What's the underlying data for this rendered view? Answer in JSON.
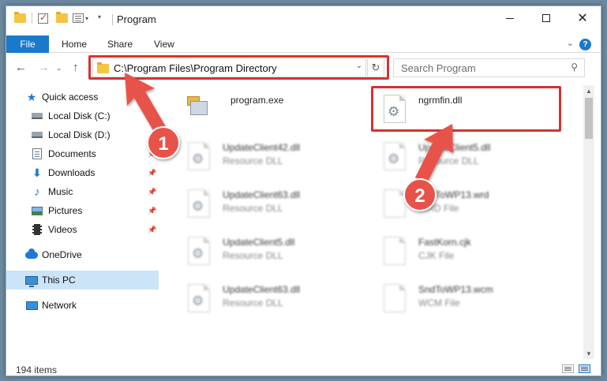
{
  "window": {
    "title": "Program"
  },
  "ribbon": {
    "file_label": "File",
    "tabs": [
      "Home",
      "Share",
      "View"
    ],
    "help_label": "?"
  },
  "nav": {
    "address": "C:\\Program Files\\Program Directory",
    "search_placeholder": "Search Program"
  },
  "sidebar": {
    "items": [
      {
        "label": "Quick access",
        "icon": "star-icon"
      },
      {
        "label": "Local Disk (C:)",
        "icon": "drive-icon"
      },
      {
        "label": "Local Disk (D:)",
        "icon": "drive-icon"
      },
      {
        "label": "Documents",
        "icon": "documents-icon"
      },
      {
        "label": "Downloads",
        "icon": "downloads-icon"
      },
      {
        "label": "Music",
        "icon": "music-icon"
      },
      {
        "label": "Pictures",
        "icon": "pictures-icon"
      },
      {
        "label": "Videos",
        "icon": "videos-icon"
      },
      {
        "label": "OneDrive",
        "icon": "cloud-icon"
      },
      {
        "label": "This PC",
        "icon": "computer-icon"
      },
      {
        "label": "Network",
        "icon": "network-icon"
      }
    ]
  },
  "files": [
    {
      "name": "program.exe",
      "type": ""
    },
    {
      "name": "ngrmfin.dll",
      "type": ""
    },
    {
      "name": "UpdateClient42.dll",
      "type": "Resource DLL"
    },
    {
      "name": "UpdateClient5.dll",
      "type": "Resource DLL"
    },
    {
      "name": "UpdateClient63.dll",
      "type": "Resource DLL"
    },
    {
      "name": "SndToWP13.wrd",
      "type": "WRD File"
    },
    {
      "name": "UpdateClient5.dll",
      "type": "Resource DLL"
    },
    {
      "name": "FastKorn.cjk",
      "type": "CJK File"
    },
    {
      "name": "UpdateClient63.dll",
      "type": "Resource DLL"
    },
    {
      "name": "SndToWP13.wcm",
      "type": "WCM File"
    }
  ],
  "status": {
    "item_count": "194 items"
  },
  "callouts": {
    "one": "1",
    "two": "2"
  },
  "colors": {
    "accent": "#1979ca",
    "highlight": "#d63232",
    "selected": "#cce4f7"
  }
}
